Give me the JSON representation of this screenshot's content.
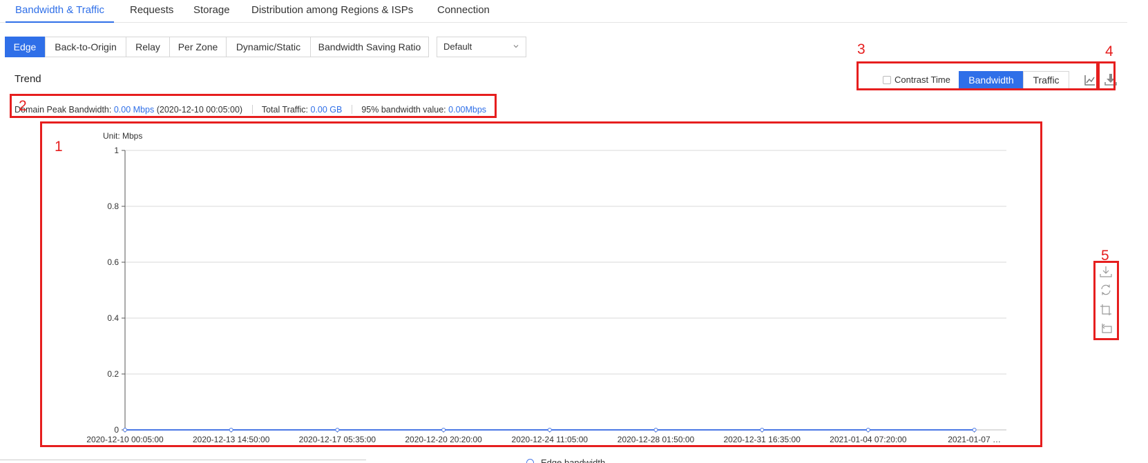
{
  "top_tabs": [
    {
      "label": "Bandwidth & Traffic",
      "active": true
    },
    {
      "label": "Requests",
      "active": false
    },
    {
      "label": "Storage",
      "active": false
    },
    {
      "label": "Distribution among Regions & ISPs",
      "active": false
    },
    {
      "label": "Connection",
      "active": false
    }
  ],
  "sub_tabs": [
    {
      "label": "Edge",
      "active": true
    },
    {
      "label": "Back-to-Origin",
      "active": false
    },
    {
      "label": "Relay",
      "active": false
    },
    {
      "label": "Per Zone",
      "active": false
    },
    {
      "label": "Dynamic/Static",
      "active": false
    },
    {
      "label": "Bandwidth Saving Ratio",
      "active": false
    }
  ],
  "select": {
    "value": "Default"
  },
  "trend": {
    "title": "Trend"
  },
  "metrics": {
    "peak_label": "Domain Peak Bandwidth:",
    "peak_value": "0.00 Mbps",
    "peak_time": "(2020-12-10 00:05:00)",
    "traffic_label": "Total Traffic:",
    "traffic_value": "0.00 GB",
    "p95_label": "95% bandwidth value:",
    "p95_value": "0.00Mbps"
  },
  "toolbar": {
    "contrast_label": "Contrast Time",
    "bandwidth_label": "Bandwidth",
    "traffic_label": "Traffic",
    "active": "Bandwidth",
    "icons": [
      "line-chart-icon",
      "download-icon"
    ]
  },
  "chart_tools": {
    "icons": [
      "save-image-icon",
      "restore-icon",
      "zoom-icon",
      "zoom-reset-icon"
    ]
  },
  "annotations": [
    "1",
    "2",
    "3",
    "4",
    "5"
  ],
  "colors": {
    "accent": "#2f6fe8",
    "annotation": "#e61e1e",
    "series": "#4a78e6"
  },
  "legend": {
    "series_label": "Edge bandwidth"
  },
  "chart_data": {
    "type": "line",
    "unit_label": "Unit: Mbps",
    "ylim": [
      0,
      1
    ],
    "yticks": [
      "0",
      "0.2",
      "0.4",
      "0.6",
      "0.8",
      "1"
    ],
    "x": [
      "2020-12-10 00:05:00",
      "2020-12-13 14:50:00",
      "2020-12-17 05:35:00",
      "2020-12-20 20:20:00",
      "2020-12-24 11:05:00",
      "2020-12-28 01:50:00",
      "2020-12-31 16:35:00",
      "2021-01-04 07:20:00",
      "2021-01-07 …"
    ],
    "series": [
      {
        "name": "Edge bandwidth",
        "values": [
          0,
          0,
          0,
          0,
          0,
          0,
          0,
          0,
          0
        ]
      }
    ],
    "grid": true
  }
}
